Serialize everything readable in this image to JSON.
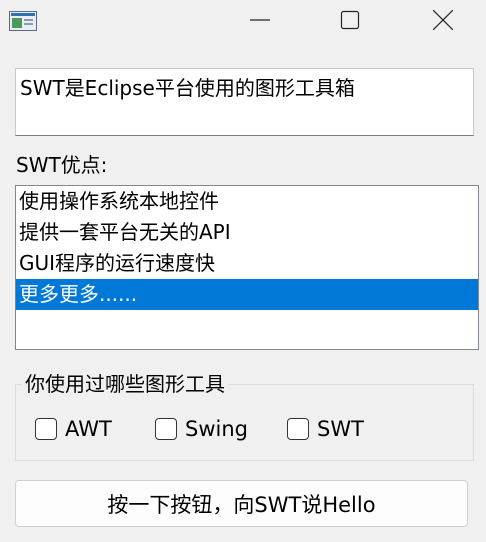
{
  "window": {
    "icons": {
      "app": "app-window-icon",
      "minimize": "minimize-icon",
      "maximize": "maximize-icon",
      "close": "close-icon"
    }
  },
  "textbox": {
    "value": "SWT是Eclipse平台使用的图形工具箱"
  },
  "advantages": {
    "label": "SWT优点:",
    "items": [
      "使用操作系统本地控件",
      "提供一套平台无关的API",
      "GUI程序的运行速度快",
      "更多更多......"
    ],
    "selected_index": 3
  },
  "toolkits": {
    "title": "你使用过哪些图形工具",
    "options": [
      {
        "label": "AWT",
        "checked": false
      },
      {
        "label": "Swing",
        "checked": false
      },
      {
        "label": "SWT",
        "checked": false
      }
    ]
  },
  "action_button": {
    "label": "按一下按钮，向SWT说Hello"
  },
  "colors": {
    "selection": "#0078d7",
    "background": "#f0f0f0"
  }
}
